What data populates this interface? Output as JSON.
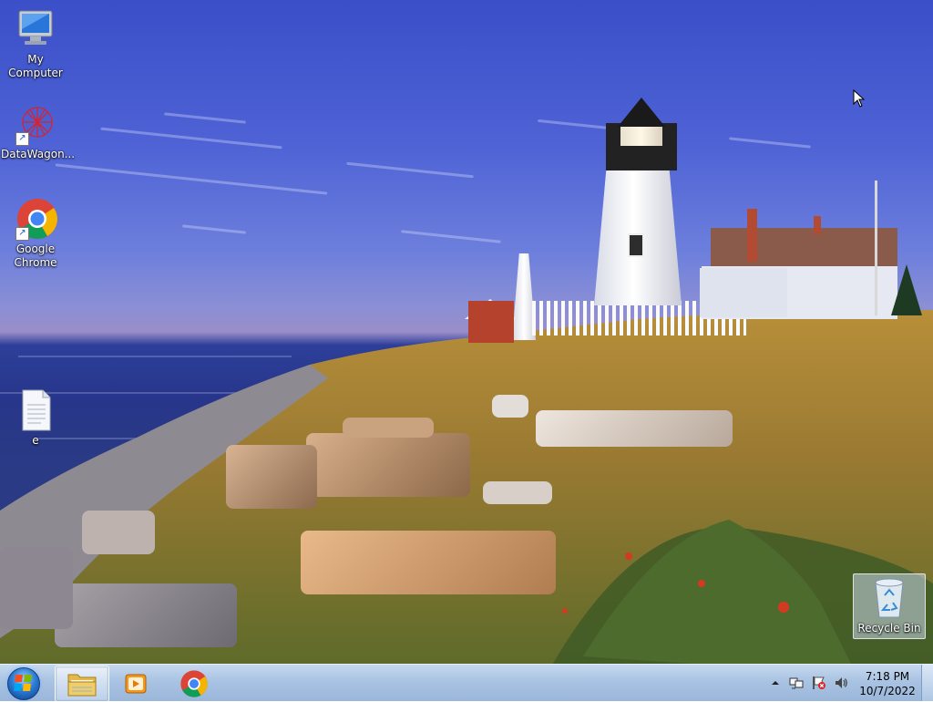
{
  "desktop": {
    "icons": [
      {
        "label": "My Computer",
        "icon": "computer-icon"
      },
      {
        "label": "DataWagon...",
        "icon": "datawagon-icon"
      },
      {
        "label": "Google Chrome",
        "icon": "chrome-icon"
      },
      {
        "label": "e",
        "icon": "text-file-icon"
      },
      {
        "label": "Recycle Bin",
        "icon": "recycle-bin-icon"
      }
    ]
  },
  "taskbar": {
    "start_icon": "windows-start-orb-icon",
    "pinned": [
      {
        "name": "Windows Explorer",
        "icon": "folder-explorer-icon"
      },
      {
        "name": "Windows Media Player",
        "icon": "media-player-icon"
      },
      {
        "name": "Google Chrome",
        "icon": "chrome-icon"
      }
    ],
    "tray_icons": [
      "show-hidden-icons-chevron-icon",
      "network-icon",
      "action-center-flag-icon",
      "volume-icon"
    ],
    "clock": {
      "time": "7:18 PM",
      "date": "10/7/2022"
    }
  },
  "colors": {
    "taskbar": "#a9c3e3",
    "sky": "#4f63d6",
    "accent": "#2d7ed6"
  }
}
